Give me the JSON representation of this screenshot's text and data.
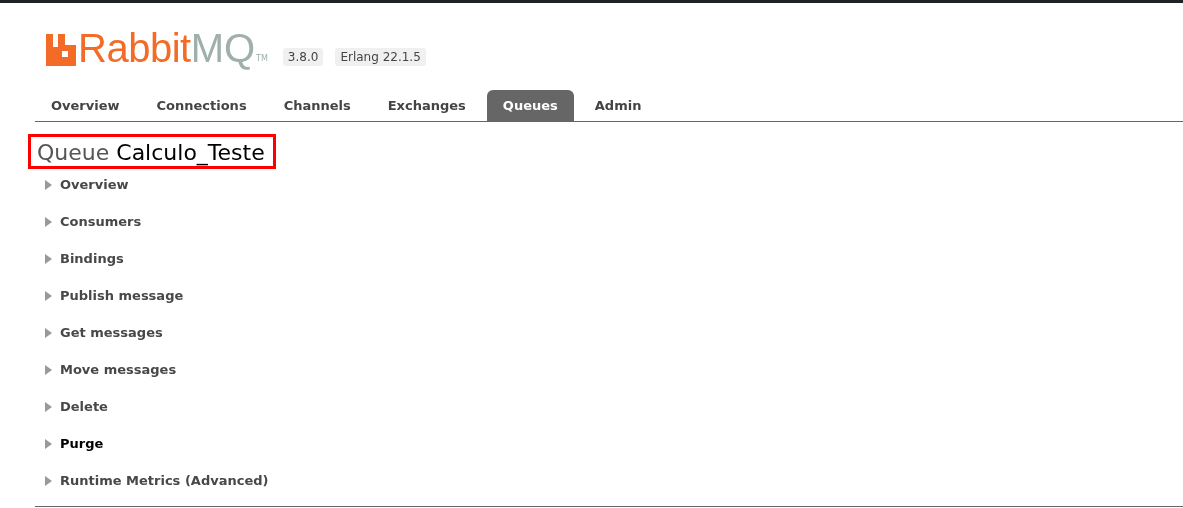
{
  "logo": {
    "part_1": "Rabbit",
    "part_2": "MQ",
    "trademark": "TM"
  },
  "badges": [
    "3.8.0",
    "Erlang 22.1.5"
  ],
  "tabs": [
    {
      "label": "Overview",
      "selected": false
    },
    {
      "label": "Connections",
      "selected": false
    },
    {
      "label": "Channels",
      "selected": false
    },
    {
      "label": "Exchanges",
      "selected": false
    },
    {
      "label": "Queues",
      "selected": true
    },
    {
      "label": "Admin",
      "selected": false
    }
  ],
  "title": {
    "prefix": "Queue",
    "name": "Calculo_Teste",
    "outlined": true
  },
  "sections": [
    {
      "label": "Overview",
      "expanded": false,
      "hovered": false
    },
    {
      "label": "Consumers",
      "expanded": false,
      "hovered": false
    },
    {
      "label": "Bindings",
      "expanded": false,
      "hovered": false
    },
    {
      "label": "Publish message",
      "expanded": false,
      "hovered": false
    },
    {
      "label": "Get messages",
      "expanded": false,
      "hovered": false
    },
    {
      "label": "Move messages",
      "expanded": false,
      "hovered": false
    },
    {
      "label": "Delete",
      "expanded": false,
      "hovered": false
    },
    {
      "label": "Purge",
      "expanded": false,
      "hovered": true
    },
    {
      "label": "Runtime Metrics (Advanced)",
      "expanded": false,
      "hovered": false
    }
  ]
}
